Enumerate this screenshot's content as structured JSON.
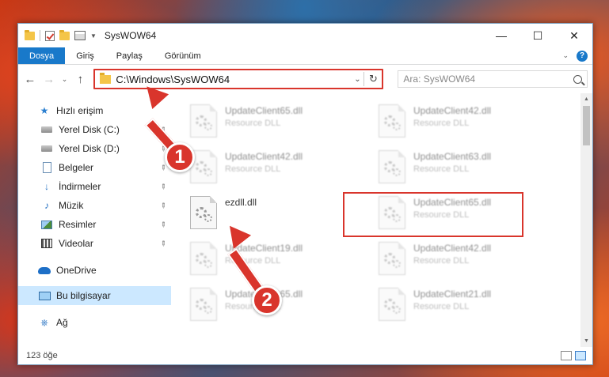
{
  "window": {
    "title": "SysWOW64",
    "controls": {
      "minimize": "—",
      "maximize": "☐",
      "close": "✕"
    }
  },
  "ribbon": {
    "tabs": [
      {
        "label": "Dosya",
        "active": true
      },
      {
        "label": "Giriş"
      },
      {
        "label": "Paylaş"
      },
      {
        "label": "Görünüm"
      }
    ]
  },
  "address": {
    "path": "C:\\Windows\\SysWOW64"
  },
  "search": {
    "placeholder": "Ara: SysWOW64"
  },
  "sidebar": {
    "items": [
      {
        "label": "Hızlı erişim",
        "icon": "star-icon"
      },
      {
        "label": "Yerel Disk (C:)",
        "icon": "disk-icon",
        "pinned": true
      },
      {
        "label": "Yerel Disk (D:)",
        "icon": "disk-icon",
        "pinned": true
      },
      {
        "label": "Belgeler",
        "icon": "document-icon",
        "pinned": true
      },
      {
        "label": "İndirmeler",
        "icon": "download-icon",
        "pinned": true
      },
      {
        "label": "Müzik",
        "icon": "music-icon",
        "pinned": true
      },
      {
        "label": "Resimler",
        "icon": "pictures-icon",
        "pinned": true
      },
      {
        "label": "Videolar",
        "icon": "videos-icon",
        "pinned": true
      },
      {
        "label": "OneDrive",
        "icon": "cloud-icon"
      },
      {
        "label": "Bu bilgisayar",
        "icon": "computer-icon",
        "selected": true
      },
      {
        "label": "Ağ",
        "icon": "network-icon"
      }
    ]
  },
  "files": [
    {
      "name": "UpdateClient65.dll",
      "desc": "Resource DLL",
      "blurred": true
    },
    {
      "name": "UpdateClient42.dll",
      "desc": "Resource DLL",
      "blurred": true
    },
    {
      "name": "UpdateClient42.dll",
      "desc": "Resource DLL",
      "blurred": true
    },
    {
      "name": "UpdateClient63.dll",
      "desc": "Resource DLL",
      "blurred": true
    },
    {
      "name": "ezdll.dll",
      "desc": "",
      "blurred": false
    },
    {
      "name": "UpdateClient65.dll",
      "desc": "Resource DLL",
      "blurred": true
    },
    {
      "name": "UpdateClient19.dll",
      "desc": "Resource DLL",
      "blurred": true
    },
    {
      "name": "UpdateClient42.dll",
      "desc": "Resource DLL",
      "blurred": true
    },
    {
      "name": "UpdateClient65.dll",
      "desc": "Resource DLL",
      "blurred": true
    },
    {
      "name": "UpdateClient21.dll",
      "desc": "Resource DLL",
      "blurred": true
    }
  ],
  "status": {
    "count": "123 öğe"
  },
  "annotations": {
    "step1": "1",
    "step2": "2",
    "color": "#d9352c"
  }
}
